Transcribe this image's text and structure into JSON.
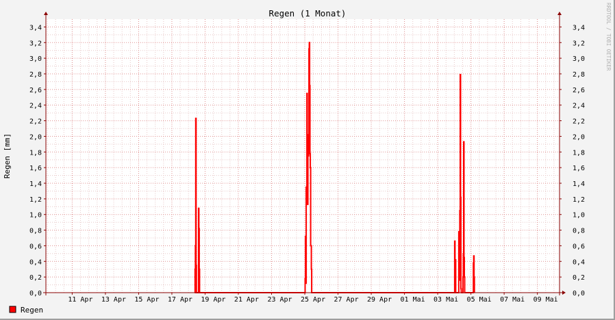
{
  "chart_data": {
    "type": "line",
    "title": "Regen (1 Monat)",
    "ylabel": "Regen [mm]",
    "xlabel": "",
    "watermark": "RRDTOOL / TOBI OETIKER",
    "ylim": [
      0,
      3.5
    ],
    "y_ticks": [
      "0,0",
      "0,2",
      "0,4",
      "0,6",
      "0,8",
      "1,0",
      "1,2",
      "1,4",
      "1,6",
      "1,8",
      "2,0",
      "2,2",
      "2,4",
      "2,6",
      "2,8",
      "3,0",
      "3,2",
      "3,4"
    ],
    "y_tick_values": [
      0,
      0.2,
      0.4,
      0.6,
      0.8,
      1.0,
      1.2,
      1.4,
      1.6,
      1.8,
      2.0,
      2.2,
      2.4,
      2.6,
      2.8,
      3.0,
      3.2,
      3.4
    ],
    "x_range_days": [
      "2024-04-09T10:00",
      "2024-05-10T08:00"
    ],
    "x_ticks": [
      {
        "date": "2024-04-11",
        "label": "11 Apr"
      },
      {
        "date": "2024-04-13",
        "label": "13 Apr"
      },
      {
        "date": "2024-04-15",
        "label": "15 Apr"
      },
      {
        "date": "2024-04-17",
        "label": "17 Apr"
      },
      {
        "date": "2024-04-19",
        "label": "19 Apr"
      },
      {
        "date": "2024-04-21",
        "label": "21 Apr"
      },
      {
        "date": "2024-04-23",
        "label": "23 Apr"
      },
      {
        "date": "2024-04-25",
        "label": "25 Apr"
      },
      {
        "date": "2024-04-27",
        "label": "27 Apr"
      },
      {
        "date": "2024-04-29",
        "label": "29 Apr"
      },
      {
        "date": "2024-05-01",
        "label": "01 Mai"
      },
      {
        "date": "2024-05-03",
        "label": "03 Mai"
      },
      {
        "date": "2024-05-05",
        "label": "05 Mai"
      },
      {
        "date": "2024-05-07",
        "label": "07 Mai"
      },
      {
        "date": "2024-05-09",
        "label": "09 Mai"
      }
    ],
    "grid": true,
    "legend_position": "bottom-left",
    "colors": {
      "series": "#ff0000",
      "grid_minor": "#e8c8c8",
      "grid_major": "#e09090",
      "axis": "#8a0000",
      "canvas": "#ffffff",
      "background": "#f3f3f3"
    },
    "series": [
      {
        "name": "Regen",
        "points": [
          [
            "2024-04-18T09:00",
            0
          ],
          [
            "2024-04-18T09:30",
            0.3
          ],
          [
            "2024-04-18T10:00",
            0.6
          ],
          [
            "2024-04-18T10:30",
            2.23
          ],
          [
            "2024-04-18T11:00",
            0.35
          ],
          [
            "2024-04-18T11:30",
            0
          ],
          [
            "2024-04-18T14:00",
            0
          ],
          [
            "2024-04-18T14:30",
            1.08
          ],
          [
            "2024-04-18T15:00",
            0.82
          ],
          [
            "2024-04-18T15:30",
            0.3
          ],
          [
            "2024-04-18T16:00",
            0
          ],
          [
            "2024-04-25T00:00",
            0
          ],
          [
            "2024-04-25T00:30",
            0.18
          ],
          [
            "2024-04-25T01:00",
            0.72
          ],
          [
            "2024-04-25T01:30",
            0.12
          ],
          [
            "2024-04-25T02:00",
            1.35
          ],
          [
            "2024-04-25T03:00",
            2.55
          ],
          [
            "2024-04-25T03:30",
            1.4
          ],
          [
            "2024-04-25T04:00",
            1.13
          ],
          [
            "2024-04-25T04:30",
            1.86
          ],
          [
            "2024-04-25T05:00",
            1.75
          ],
          [
            "2024-04-25T05:30",
            2.02
          ],
          [
            "2024-04-25T06:00",
            3.12
          ],
          [
            "2024-04-25T06:30",
            3.2
          ],
          [
            "2024-04-25T07:00",
            2.65
          ],
          [
            "2024-04-25T07:30",
            1.78
          ],
          [
            "2024-04-25T08:00",
            1.6
          ],
          [
            "2024-04-25T08:30",
            0.6
          ],
          [
            "2024-04-25T09:30",
            0.3
          ],
          [
            "2024-04-25T10:00",
            0
          ],
          [
            "2024-05-04T00:00",
            0
          ],
          [
            "2024-05-04T00:30",
            0.66
          ],
          [
            "2024-05-04T01:00",
            0.08
          ],
          [
            "2024-05-04T01:30",
            0.42
          ],
          [
            "2024-05-04T02:00",
            0
          ],
          [
            "2024-05-04T06:00",
            0
          ],
          [
            "2024-05-04T06:30",
            0.78
          ],
          [
            "2024-05-04T07:00",
            0.16
          ],
          [
            "2024-05-04T07:30",
            0.55
          ],
          [
            "2024-05-04T08:00",
            1.05
          ],
          [
            "2024-05-04T08:30",
            2.79
          ],
          [
            "2024-05-04T09:00",
            1.22
          ],
          [
            "2024-05-04T09:30",
            0.05
          ],
          [
            "2024-05-04T10:00",
            0
          ],
          [
            "2024-05-04T12:00",
            0
          ],
          [
            "2024-05-04T12:30",
            0.2
          ],
          [
            "2024-05-04T13:00",
            0.5
          ],
          [
            "2024-05-04T13:30",
            1.93
          ],
          [
            "2024-05-04T14:00",
            0.45
          ],
          [
            "2024-05-04T14:30",
            0.2
          ],
          [
            "2024-05-04T15:00",
            0
          ],
          [
            "2024-05-05T03:00",
            0
          ],
          [
            "2024-05-05T03:30",
            0.38
          ],
          [
            "2024-05-05T04:00",
            0.47
          ],
          [
            "2024-05-05T04:30",
            0.2
          ],
          [
            "2024-05-05T05:00",
            0
          ]
        ]
      }
    ]
  }
}
